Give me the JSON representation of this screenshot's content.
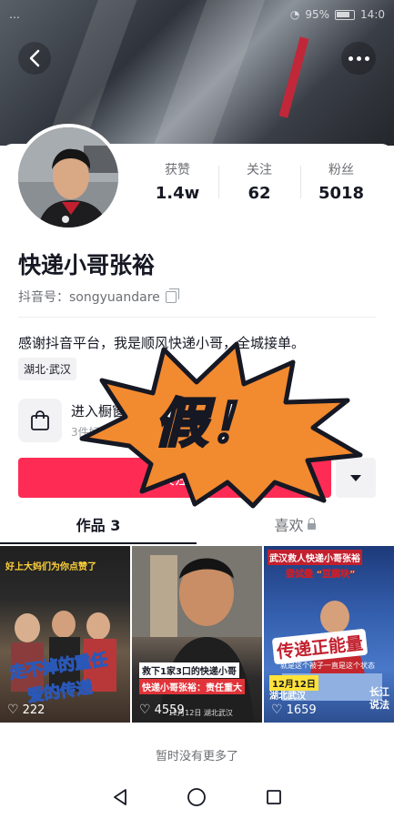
{
  "status_bar": {
    "left_text": "…",
    "battery": "95%",
    "time": "14:0"
  },
  "profile": {
    "name": "快递小哥张裕",
    "id_label": "抖音号：",
    "id_value": "songyuandare",
    "bio": "感谢抖音平台，我是顺风快递小哥，全城接单。",
    "location": "湖北·武汉"
  },
  "stats": [
    {
      "label": "获赞",
      "value": "1.4w"
    },
    {
      "label": "关注",
      "value": "62"
    },
    {
      "label": "粉丝",
      "value": "5018"
    }
  ],
  "shop": {
    "title": "进入橱窗",
    "subtitle": "3件好物"
  },
  "follow_label": "关注",
  "sticker_text": "假！",
  "tabs": [
    {
      "label": "作品 3"
    },
    {
      "label": "喜欢"
    }
  ],
  "videos": [
    {
      "caption_top": "好上大妈们为你点赞了",
      "caption_main1": "走不掉的重任",
      "caption_main2": "爱的传递",
      "likes": "222"
    },
    {
      "caption_top": "救下1家3口的快递小哥",
      "caption_main1": "快递小哥张裕：责任重大",
      "likes": "4559",
      "date": "12月12日 湖北武汉"
    },
    {
      "caption_top": "武汉救人快递小哥张裕",
      "caption_main1": "尝试叠 “豆腐块”",
      "caption_main2": "传递正能量",
      "sub": "就是这个被子一直是这个状态",
      "date1": "12月12日",
      "date2": "湖北武汉",
      "watermark": "长江说法",
      "likes": "1659"
    }
  ],
  "no_more": "暂时没有更多了",
  "colors": {
    "accent": "#fe2c55",
    "sticker_fill": "#f28a30",
    "text": "#161823",
    "muted": "#6d6f74"
  }
}
